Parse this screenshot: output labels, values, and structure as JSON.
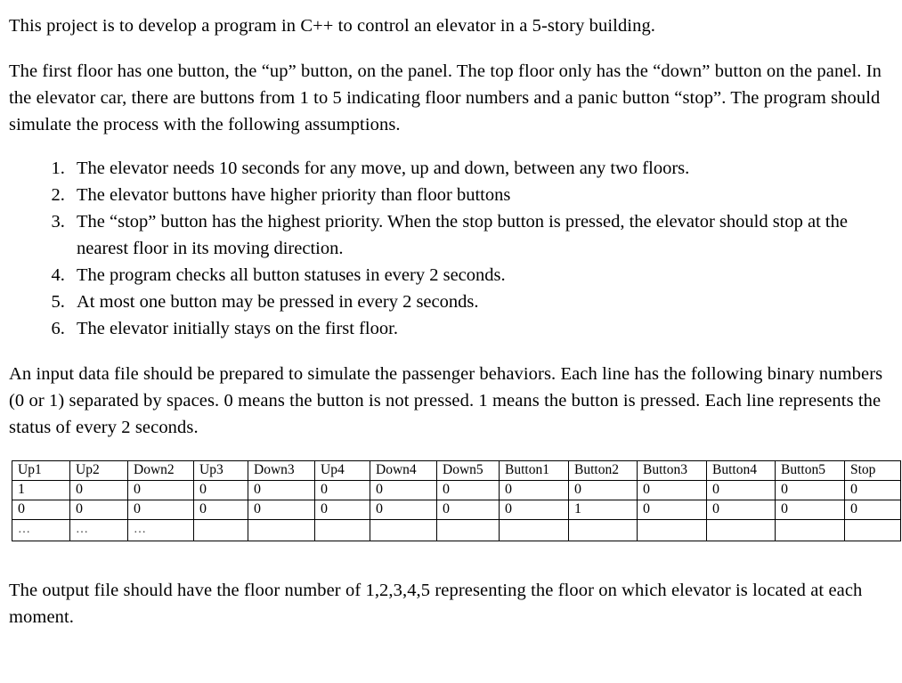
{
  "document": {
    "paragraphs": {
      "intro": "This project is to develop a program in C++ to control an elevator in a 5-story building.",
      "floors": "The first floor has one button, the “up” button, on the panel. The top floor only has the “down” button on the panel. In the elevator car, there are buttons from 1 to 5 indicating floor numbers and a panic button “stop”. The program should simulate the process with the following assumptions.",
      "input_file": "An input data file should be prepared to simulate the passenger behaviors. Each line has the following binary numbers (0 or 1) separated by spaces. 0 means the button is not pressed. 1 means the button is pressed. Each line represents the status of every 2 seconds.",
      "output_file": "The output file should have the floor number of 1,2,3,4,5 representing the floor on which elevator is located at each moment."
    },
    "assumptions": [
      "The elevator needs 10 seconds for any move, up and down, between any two floors.",
      "The elevator buttons have higher priority than floor buttons",
      "The “stop” button has the highest priority. When the stop button is pressed, the elevator should stop at the nearest floor in its moving direction.",
      "The program checks all button statuses in every 2 seconds.",
      "At most one button may be pressed in every 2 seconds.",
      "The elevator initially stays on the first floor."
    ],
    "status_table": {
      "headers": [
        "Up1",
        "Up2",
        "Down2",
        "Up3",
        "Down3",
        "Up4",
        "Down4",
        "Down5",
        "Button1",
        "Button2",
        "Button3",
        "Button4",
        "Button5",
        "Stop"
      ],
      "rows": [
        [
          "1",
          "0",
          "0",
          "0",
          "0",
          "0",
          "0",
          "0",
          "0",
          "0",
          "0",
          "0",
          "0",
          "0"
        ],
        [
          "0",
          "0",
          "0",
          "0",
          "0",
          "0",
          "0",
          "0",
          "0",
          "1",
          "0",
          "0",
          "0",
          "0"
        ],
        [
          "…",
          "…",
          "…",
          "",
          "",
          "",
          "",
          "",
          "",
          "",
          "",
          "",
          "",
          ""
        ]
      ]
    }
  },
  "colors": {
    "page_background": "#ffffff",
    "text": "#000000",
    "table_border": "#000000"
  }
}
